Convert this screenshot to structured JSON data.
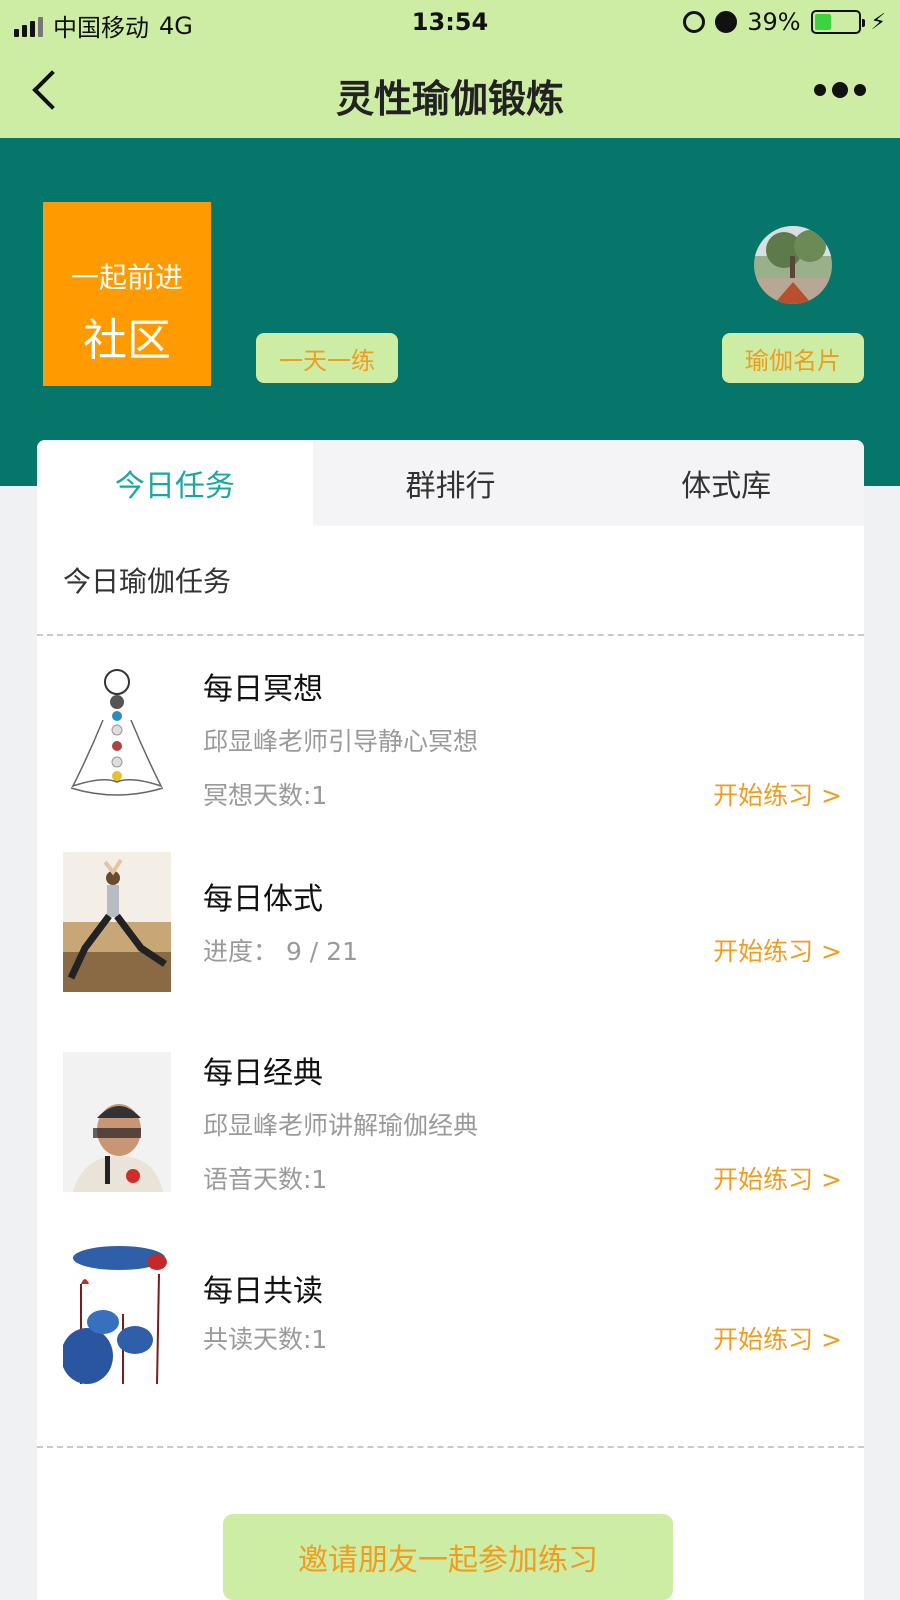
{
  "status_bar": {
    "carrier": "中国移动",
    "network": "4G",
    "time": "13:54",
    "battery": "39%",
    "battery_level": 0.39
  },
  "nav": {
    "title": "灵性瑜伽锻炼",
    "back_icon": "chevron-left-icon",
    "more_icon": "more-dots-icon"
  },
  "banner": {
    "logo_line1": "一起前进",
    "logo_line2": "社区",
    "daily_button": "一天一练",
    "card_button": "瑜伽名片"
  },
  "tabs": [
    {
      "label": "今日任务",
      "active": true
    },
    {
      "label": "群排行",
      "active": false
    },
    {
      "label": "体式库",
      "active": false
    }
  ],
  "section_title": "今日瑜伽任务",
  "tasks": [
    {
      "name": "每日冥想",
      "desc": "邱显峰老师引导静心冥想",
      "stat": "冥想天数:1",
      "action": "开始练习 >"
    },
    {
      "name": "每日体式",
      "desc": "",
      "stat": "进度： 9 / 21",
      "action": "开始练习 >"
    },
    {
      "name": "每日经典",
      "desc": "邱显峰老师讲解瑜伽经典",
      "stat": "语音天数:1",
      "action": "开始练习 >"
    },
    {
      "name": "每日共读",
      "desc": "",
      "stat": "共读天数:1",
      "action": "开始练习 >"
    }
  ],
  "invite_button": "邀请朋友一起参加练习",
  "colors": {
    "header_bg": "#cdeca4",
    "banner_bg": "#07766a",
    "accent_orange": "#f29c1e",
    "logo_orange": "#ff9a00",
    "active_tab": "#19a8a0"
  }
}
